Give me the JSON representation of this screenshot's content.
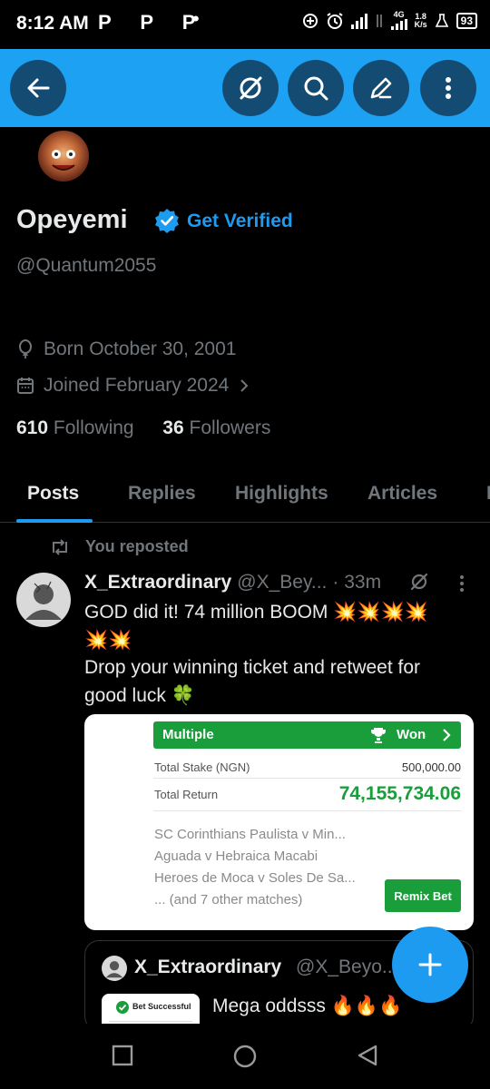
{
  "status_bar": {
    "time": "8:12 AM",
    "app_icons": "P P P",
    "dot": "•",
    "network": "4G",
    "speed_value": "1.8",
    "speed_unit": "K/s",
    "battery": "93"
  },
  "profile": {
    "name": "Opeyemi",
    "get_verified": "Get Verified",
    "handle": "@Quantum2055",
    "born": "Born October 30, 2001",
    "joined": "Joined February 2024",
    "following_count": "610",
    "following_label": "Following",
    "followers_count": "36",
    "followers_label": "Followers"
  },
  "tabs": [
    "Posts",
    "Replies",
    "Highlights",
    "Articles",
    "M"
  ],
  "post": {
    "repost_label": "You reposted",
    "author_name": "X_Extraordinary",
    "author_handle": "@X_Bey...",
    "time": "· 33m",
    "line1": "GOD did it! 74 million BOOM 💥💥💥💥",
    "line2": "💥💥",
    "line3": "Drop your winning ticket and retweet for",
    "line4": "good luck 🍀",
    "card": {
      "type": "Multiple",
      "status": "Won",
      "stake_label": "Total Stake (NGN)",
      "stake_value": "500,000.00",
      "return_label": "Total Return",
      "return_value": "74,155,734.06",
      "match1": "SC Corinthians Paulista v Min...",
      "match2": "Aguada v Hebraica Macabi",
      "match3": "Heroes de Moca v Soles De Sa...",
      "more": "... (and 7 other matches)",
      "remix": "Remix Bet"
    },
    "quote": {
      "author_name": "X_Extraordinary",
      "author_handle": "@X_Beyo...",
      "thumb_label": "Bet Successful",
      "text": "Mega oddsss 🔥🔥🔥"
    }
  },
  "colors": {
    "header": "#1da1f2",
    "header_button": "#144b72",
    "accent": "#1d9bf0",
    "card_green": "#1a9d3b"
  }
}
